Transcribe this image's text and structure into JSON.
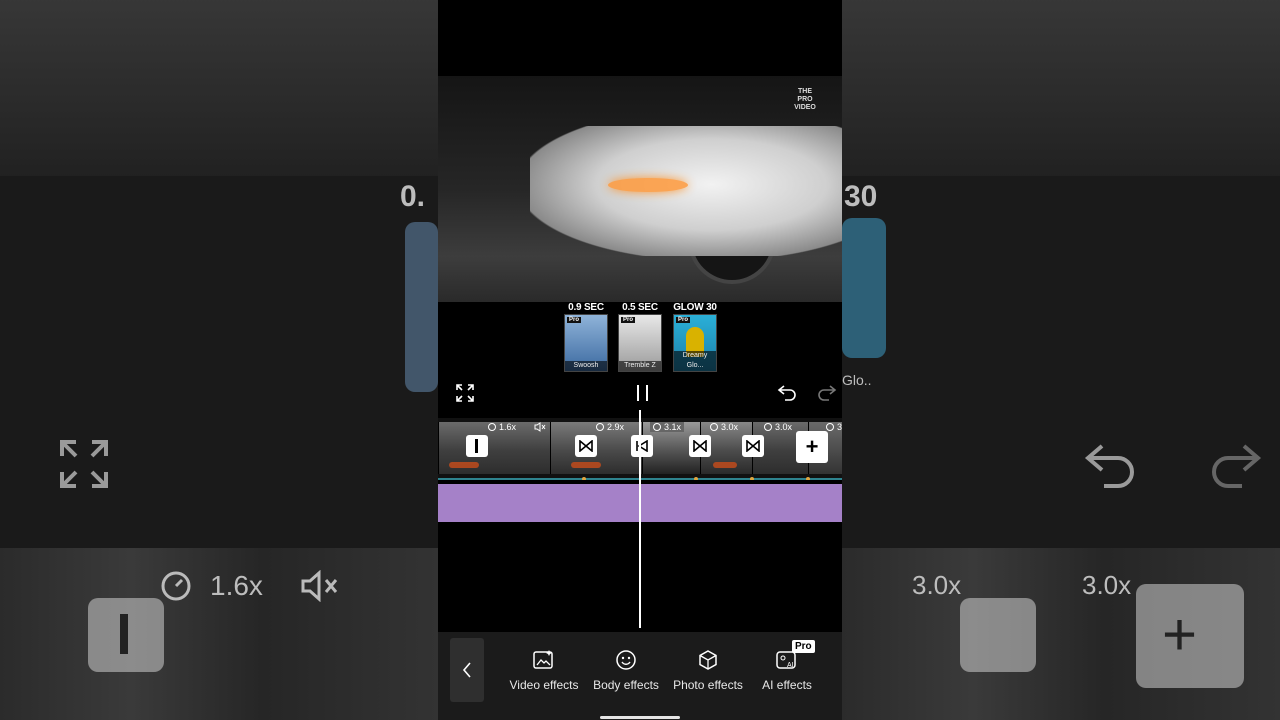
{
  "preview": {
    "watermark": "THE PRO VIDEO"
  },
  "stickers": [
    {
      "caption": "0.9 SEC",
      "label": "Swoosh",
      "badge": "Pro"
    },
    {
      "caption": "0.5 SEC",
      "label": "Tremble Z",
      "badge": "Pro"
    },
    {
      "caption": "GLOW 30",
      "label": "Dreamy Glo...",
      "badge": "Pro"
    }
  ],
  "controls": {
    "fullscreen_icon": "expand-icon",
    "pause_icon": "pause-icon",
    "undo_icon": "undo-icon",
    "redo_icon": "redo-icon"
  },
  "timeline": {
    "speeds": [
      "1.6x",
      "2.9x",
      "3.1x",
      "3.0x",
      "3.0x",
      "3"
    ],
    "add_label": "+"
  },
  "toolbar": {
    "items": [
      {
        "label": "Video effects",
        "icon": "video-effects-icon"
      },
      {
        "label": "Body effects",
        "icon": "body-effects-icon"
      },
      {
        "label": "Photo effects",
        "icon": "photo-effects-icon"
      },
      {
        "label": "AI effects",
        "icon": "ai-effects-icon"
      }
    ],
    "pro_badge": "Pro"
  },
  "background": {
    "left_caption": "0.",
    "right_caption": "30",
    "right_glow": "Glo..",
    "speed_large": "1.6x",
    "speed_right_a": "3.0x",
    "speed_right_b": "3.0x"
  },
  "colors": {
    "audio_track": "#a581c8",
    "accent_dot": "#e0a640",
    "track_line": "#3bb3c3"
  }
}
